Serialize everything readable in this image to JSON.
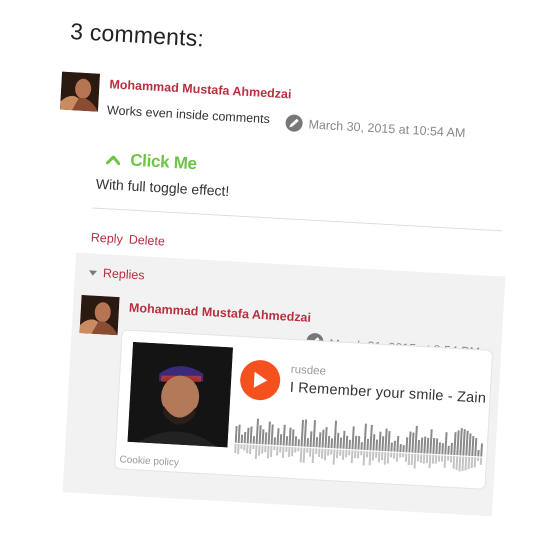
{
  "comments_heading": "3 comments:",
  "comment": {
    "author": "Mohammad Mustafa Ahmedzai",
    "date": "March 30, 2015 at 10:54 AM",
    "text": "Works even inside comments",
    "toggle": {
      "label": "Click Me",
      "content": "With full toggle effect!"
    },
    "actions": {
      "reply": "Reply",
      "delete": "Delete"
    }
  },
  "replies": {
    "toggle_label": "Replies",
    "items": [
      {
        "author": "Mohammad Mustafa Ahmedzai",
        "date": "March 31, 2015 at 8:54 PM",
        "embed": {
          "user": "rusdee",
          "title": "I Remember your smile - Zain",
          "cookie_policy": "Cookie policy"
        }
      }
    ]
  },
  "colors": {
    "accent": "#b73040",
    "toggle_green": "#6cc645",
    "soundcloud_orange": "#f5511e"
  }
}
